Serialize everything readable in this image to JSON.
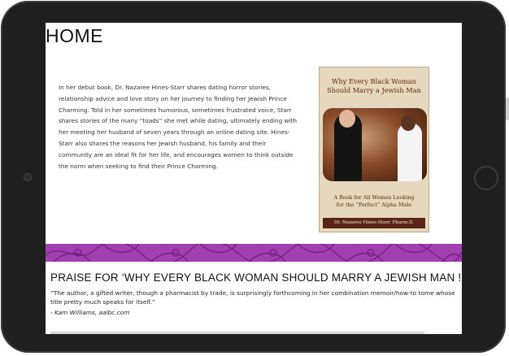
{
  "page": {
    "title": "HOME"
  },
  "intro": {
    "text": "In her debut book, Dr. Nazaree Hines-Starr shares dating horror stories, relationship advice and love story on her journey to finding her Jewish Prince Charming. Told in her sometimes humorous, sometimes frustrated voice, Starr shares stories of the many “toads” she met while dating, ultimately ending with her meeting her husband of seven years through an online dating site. Hines-Starr also shares the reasons her Jewish husband, his family and their community are an ideal fit for her life, and encourages women to think outside the norm when seeking to find their Prince Charming."
  },
  "book": {
    "title_line1": "Why Every Black Woman",
    "title_line2": "Should Marry a Jewish Man",
    "subtitle_line1": "A Book for All Women Looking",
    "subtitle_line2": "for the “Perfect” Alpha Male",
    "author": "Dr. Nazaree Hines-Starr, Pharm.D."
  },
  "praise": {
    "heading": "PRAISE FOR ‘WHY EVERY BLACK WOMAN SHOULD MARRY A JEWISH MAN ! ”",
    "quote": "“The author, a gifted writer, though a pharmacist by trade, is surprisingly forthcoming in her combination memoir/how-to tome whose title pretty much speaks for itself.”",
    "attribution": "- Kam Williams, aalbc.com"
  },
  "colors": {
    "bezel": "#1f1f1f",
    "banner": "#a23fb0",
    "book_bg": "#e6d8bf",
    "book_text": "#5a2a10"
  },
  "icons": [
    "camera-icon",
    "home-button-icon"
  ]
}
